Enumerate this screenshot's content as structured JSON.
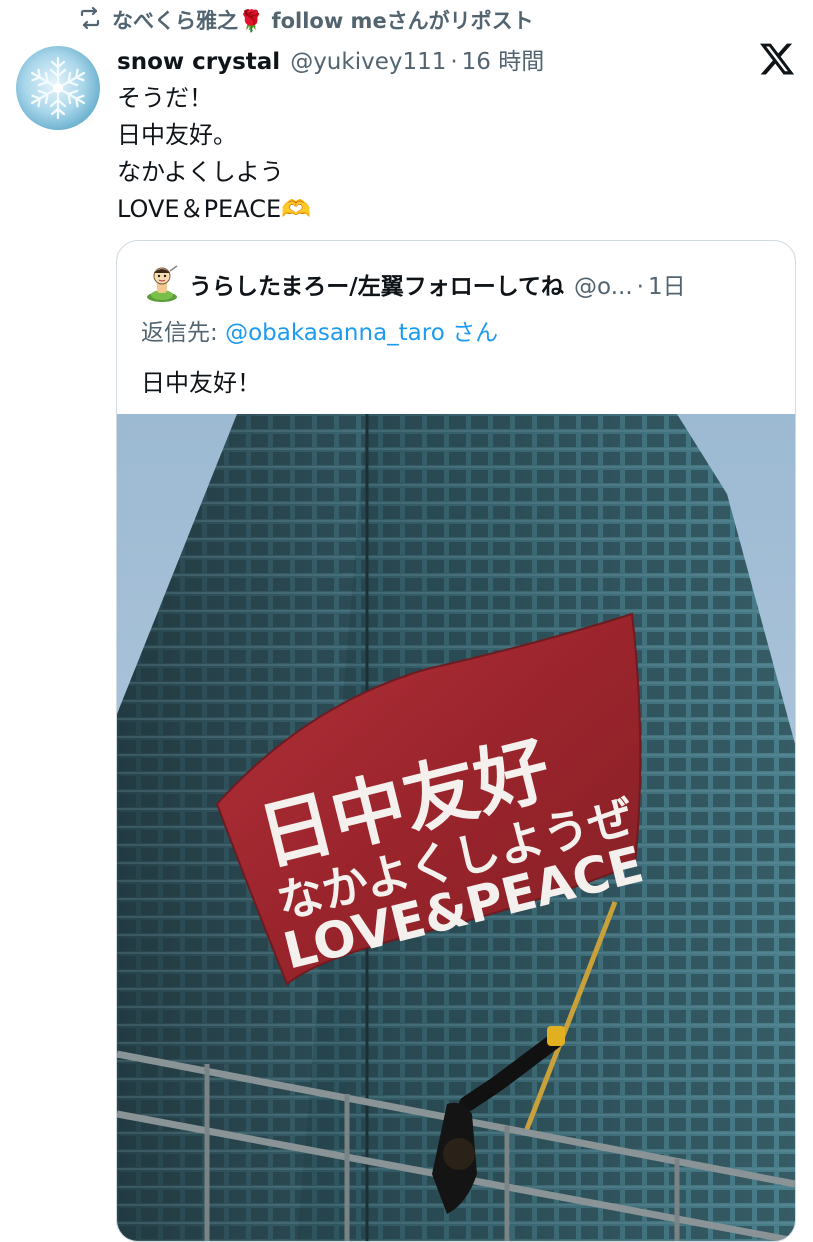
{
  "repost": {
    "icon": "repost-icon",
    "text": "なべくら雅之🌹 follow meさんがリポスト"
  },
  "tweet": {
    "avatar_icon": "snowflake-avatar",
    "display_name": "snow crystal",
    "handle": "@yukivey111",
    "separator": "·",
    "time": "16 時間",
    "lines": [
      "そうだ！",
      "日中友好。",
      "なかよくしよう",
      "LOVE＆PEACE🫶"
    ]
  },
  "x_logo": "x-logo-icon",
  "quote": {
    "avatar_icon": "cartoon-avatar",
    "display_name": "うらしたまろー/左翼フォローしてね",
    "handle": "@o...",
    "separator": "·",
    "time": "1日",
    "reply_prefix": "返信先: ",
    "reply_mention": "@obakasanna_taro",
    "reply_suffix": " さん",
    "text": "日中友好！",
    "photo": {
      "description_icon": "photo-flag-building",
      "flag_line1": "日中友好",
      "flag_line2": "なかよくしようぜ",
      "flag_line3": "LOVE&PEACE",
      "sky_color": "#a7c3db",
      "building_color": "#2f5560",
      "flag_color": "#a3262d"
    }
  }
}
